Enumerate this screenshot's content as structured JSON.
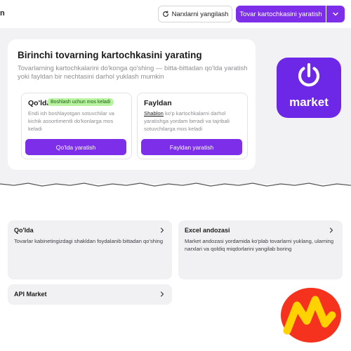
{
  "topbar": {
    "brand_fragment": "n",
    "refresh_label": "Narxlarni yangilash",
    "create_label": "Tovar kartochkasini yaratish"
  },
  "main": {
    "title": "Birinchi tovarning kartochkasini yarating",
    "subtitle": "Tovarlarning kartochkalarini do'konga qo'shing — bitta-bittadan qo'lda yaratish yoki fayldan bir nechtasini darhol yuklash mumkin",
    "options": [
      {
        "title": "Qo'lda",
        "badge": "Boshlash uchun mos keladi",
        "description": "Endi ish boshlayotgan sotuvchilar va kichik assortimentli do'konlarga mos keladi",
        "button": "Qo'lda yaratish"
      },
      {
        "title": "Fayldan",
        "description_link": "Shablon",
        "description_rest": " ko'p kartochkalarni darhol yaratishga yordam beradi va tajribali sotuvchilarga mos keladi",
        "button": "Fayldan yaratish"
      }
    ]
  },
  "logos": {
    "market_word": "market"
  },
  "tiles": [
    {
      "title": "Qo'lda",
      "description": "Tovarlar kabinetingizdagi shakldan foydalanib bittadan qo'shing"
    },
    {
      "title": "Excel andozasi",
      "description": "Market andozasi yordamida ko'plab tovarlarni yuklang, ularning narxlari va qoldiq miqdorlarini yangilab boring"
    },
    {
      "title": "API Market"
    }
  ],
  "colors": {
    "accent": "#7d2ee9",
    "badge_bg": "#b9f2a0",
    "logo_purple": "#6c28e6",
    "logo_red": "#f5321e",
    "logo_yellow": "#ffd200"
  }
}
